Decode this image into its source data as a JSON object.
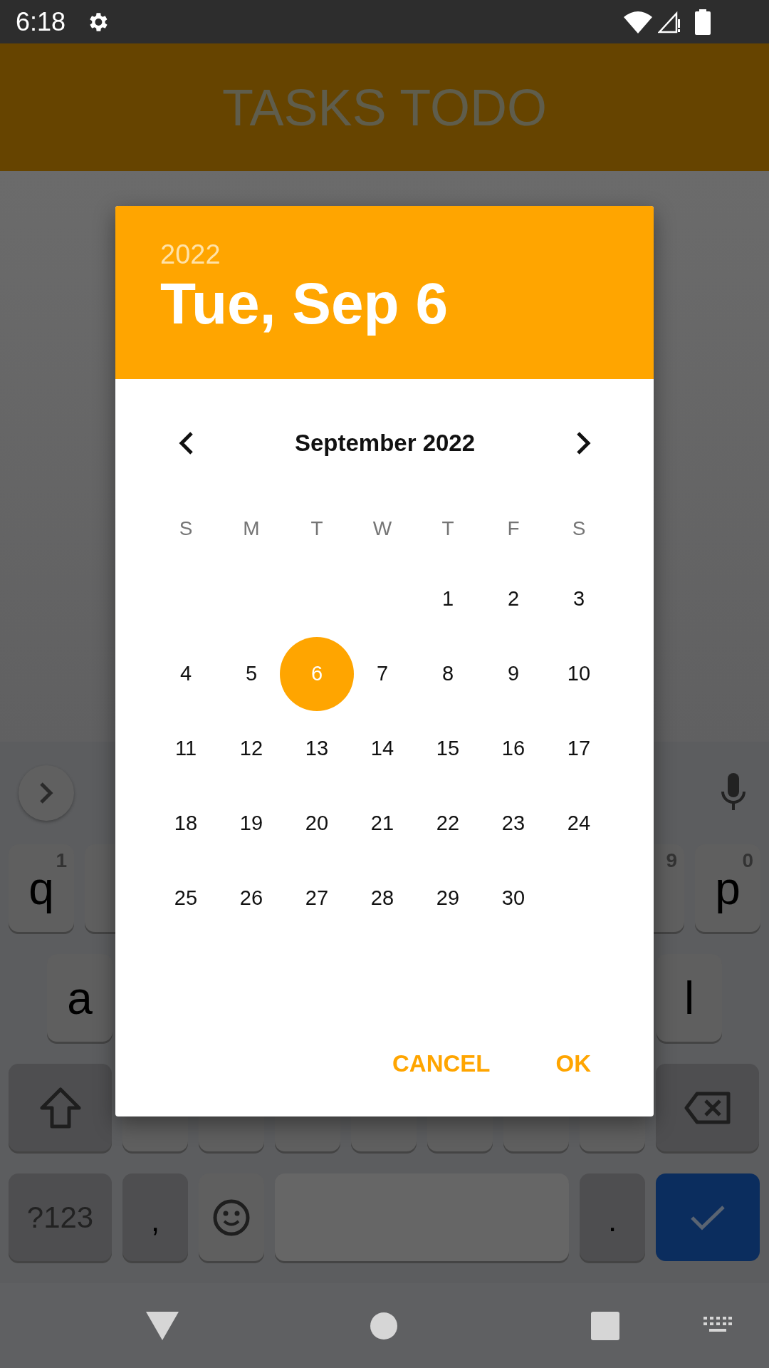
{
  "status_bar": {
    "time": "6:18"
  },
  "app_bar": {
    "title": "TASKS TODO"
  },
  "date_picker": {
    "year": "2022",
    "date": "Tue, Sep 6",
    "month": "September 2022",
    "weekdays": [
      "S",
      "M",
      "T",
      "W",
      "T",
      "F",
      "S"
    ],
    "weeks": [
      [
        {
          "day": "1",
          "selected": false
        },
        {
          "day": "2",
          "selected": false
        },
        {
          "day": "3",
          "selected": false
        }
      ],
      [
        {
          "day": "4",
          "selected": false
        },
        {
          "day": "5",
          "selected": false
        },
        {
          "day": "6",
          "selected": true
        },
        {
          "day": "7",
          "selected": false
        },
        {
          "day": "8",
          "selected": false
        },
        {
          "day": "9",
          "selected": false
        },
        {
          "day": "10",
          "selected": false
        }
      ],
      [
        {
          "day": "11",
          "selected": false
        },
        {
          "day": "12",
          "selected": false
        },
        {
          "day": "13",
          "selected": false
        },
        {
          "day": "14",
          "selected": false
        },
        {
          "day": "15",
          "selected": false
        },
        {
          "day": "16",
          "selected": false
        },
        {
          "day": "17",
          "selected": false
        }
      ],
      [
        {
          "day": "18",
          "selected": false
        },
        {
          "day": "19",
          "selected": false
        },
        {
          "day": "20",
          "selected": false
        },
        {
          "day": "21",
          "selected": false
        },
        {
          "day": "22",
          "selected": false
        },
        {
          "day": "23",
          "selected": false
        },
        {
          "day": "24",
          "selected": false
        }
      ],
      [
        {
          "day": "25",
          "selected": false
        },
        {
          "day": "26",
          "selected": false
        },
        {
          "day": "27",
          "selected": false
        },
        {
          "day": "28",
          "selected": false
        },
        {
          "day": "29",
          "selected": false
        },
        {
          "day": "30",
          "selected": false
        }
      ]
    ],
    "buttons": [
      "CANCEL",
      "OK"
    ]
  },
  "keyboard": {
    "rows": [
      {
        "left": [
          {
            "kind": "letter",
            "label": "q",
            "hint": "1"
          },
          {
            "kind": "letter"
          }
        ],
        "right": [
          {
            "kind": "letter",
            "hint": "9"
          },
          {
            "kind": "letter",
            "label": "p",
            "hint": "0"
          }
        ]
      },
      {
        "left": [
          {
            "kind": "letter",
            "label": "a"
          }
        ],
        "right": [
          {
            "kind": "letter",
            "label": "l"
          }
        ]
      },
      {
        "left": [
          {
            "kind": "shift"
          },
          {
            "kind": "letter"
          },
          {
            "kind": "letter"
          },
          {
            "kind": "letter"
          },
          {
            "kind": "letter"
          },
          {
            "kind": "letter"
          },
          {
            "kind": "letter"
          },
          {
            "kind": "letter"
          },
          {
            "kind": "backspace"
          }
        ]
      },
      {
        "left": [
          {
            "kind": "symbols",
            "label": "?123"
          },
          {
            "kind": "comma",
            "label": ","
          },
          {
            "kind": "emoji"
          },
          {
            "kind": "space"
          },
          {
            "kind": "period",
            "label": "."
          },
          {
            "kind": "enter"
          }
        ]
      }
    ]
  }
}
